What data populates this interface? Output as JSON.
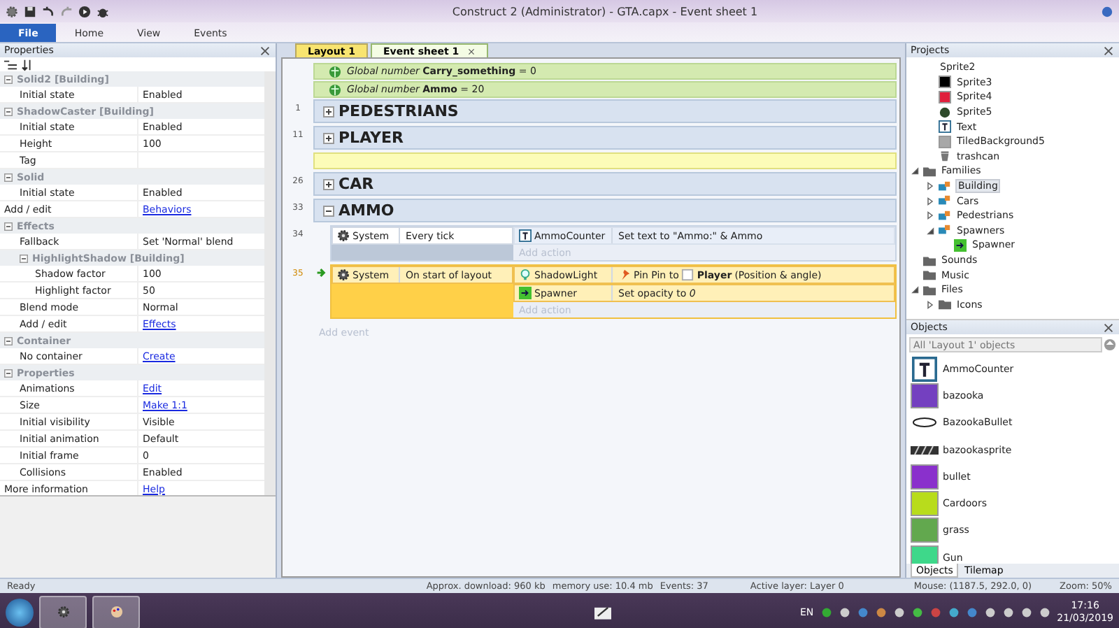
{
  "window": {
    "title": "Construct 2 (Administrator) - GTA.capx - Event sheet 1"
  },
  "ribbon_tabs": [
    {
      "label": "File",
      "kind": "file",
      "selected": false
    },
    {
      "label": "Home",
      "kind": "tab",
      "selected": false
    },
    {
      "label": "View",
      "kind": "tab",
      "selected": false
    },
    {
      "label": "Events",
      "kind": "tab",
      "selected": false
    }
  ],
  "properties": {
    "title": "Properties",
    "items": [
      {
        "kind": "group",
        "children": [
          {
            "kind": "group",
            "label": "Solid2 [Building]",
            "children": [
              {
                "kind": "row",
                "label": "Initial state",
                "value": "Enabled",
                "link": false
              }
            ]
          },
          {
            "kind": "group",
            "label": "ShadowCaster [Building]",
            "children": [
              {
                "kind": "row",
                "label": "Initial state",
                "value": "Enabled",
                "link": false
              },
              {
                "kind": "row",
                "label": "Height",
                "value": "100",
                "link": false
              },
              {
                "kind": "row",
                "label": "Tag"
              }
            ]
          },
          {
            "kind": "group",
            "label": "Solid",
            "children": [
              {
                "kind": "row",
                "label": "Initial state",
                "value": "Enabled",
                "link": false
              }
            ]
          },
          {
            "kind": "row",
            "label": "Add / edit",
            "value": "Behaviors",
            "link": true
          }
        ]
      },
      {
        "kind": "group",
        "label": "Effects",
        "children": [
          {
            "kind": "row",
            "label": "Fallback",
            "value": "Set 'Normal' blend",
            "link": false
          },
          {
            "kind": "group",
            "label": "HighlightShadow [Building]",
            "children": [
              {
                "kind": "row",
                "label": "Shadow factor",
                "value": "100",
                "link": false
              },
              {
                "kind": "row",
                "label": "Highlight factor",
                "value": "50",
                "link": false
              }
            ]
          },
          {
            "kind": "row",
            "label": "Blend mode",
            "value": "Normal",
            "link": false
          },
          {
            "kind": "row",
            "label": "Add / edit",
            "value": "Effects",
            "link": true
          }
        ]
      },
      {
        "kind": "group",
        "label": "Container",
        "children": [
          {
            "kind": "row",
            "label": "No container",
            "value": "Create",
            "link": true
          }
        ]
      },
      {
        "kind": "group",
        "label": "Properties",
        "children": [
          {
            "kind": "row",
            "label": "Animations",
            "value": "Edit",
            "link": true
          },
          {
            "kind": "row",
            "label": "Size",
            "value": "Make 1:1",
            "link": true
          },
          {
            "kind": "row",
            "label": "Initial visibility",
            "value": "Visible",
            "link": false
          },
          {
            "kind": "row",
            "label": "Initial animation",
            "value": "Default",
            "link": false
          },
          {
            "kind": "row",
            "label": "Initial frame",
            "value": "0",
            "link": false
          },
          {
            "kind": "row",
            "label": "Collisions",
            "value": "Enabled",
            "link": false
          }
        ]
      },
      {
        "kind": "row",
        "label": "More information",
        "value": "Help",
        "link": true
      }
    ]
  },
  "doc_tabs": [
    {
      "label": "Layout 1",
      "kind": "layout",
      "selected": false
    },
    {
      "label": "Event sheet 1",
      "kind": "events",
      "selected": true
    }
  ],
  "event_sheet": {
    "rows": [
      {
        "kind": "global",
        "text": "*Global number* **Carry_something** = 0"
      },
      {
        "kind": "global",
        "text": "*Global number* **Ammo** = 20"
      },
      {
        "kind": "group",
        "number": "1",
        "title": "PEDESTRIANS",
        "expanded": false
      },
      {
        "kind": "group",
        "number": "11",
        "title": "PLAYER",
        "expanded": false
      },
      {
        "kind": "comment"
      },
      {
        "kind": "group",
        "number": "26",
        "title": "CAR",
        "expanded": false
      },
      {
        "kind": "group",
        "number": "33",
        "title": "AMMO",
        "expanded": true,
        "children": [
          {
            "kind": "event",
            "number": "34",
            "selected": false,
            "trigger": false,
            "conditions": [
              {
                "object": "System",
                "kind": "system",
                "text": "Every tick"
              }
            ],
            "actions": [
              {
                "object": "AmmoCounter",
                "kind": "text_object",
                "text": "Set text to \"Ammo:\" & Ammo"
              }
            ],
            "add_action": "Add action"
          },
          {
            "kind": "event",
            "number": "35",
            "selected": true,
            "trigger": true,
            "conditions": [
              {
                "object": "System",
                "kind": "system",
                "text": "On start of layout"
              }
            ],
            "actions": [
              {
                "object": "ShadowLight",
                "kind": "light",
                "text": "Pin Pin to",
                "param_object": "Player",
                "suffix": "(Position & angle)"
              },
              {
                "object": "Spawner",
                "kind": "sprite",
                "text": "Set opacity to *0*"
              }
            ],
            "add_action": "Add action"
          }
        ]
      }
    ],
    "add_event": "Add event"
  },
  "projects": {
    "title": "Projects",
    "tree": [
      {
        "children": [
          {
            "children": [
              {
                "label": "Sprite2",
                "kind": "none",
                "selected": false
              },
              {
                "label": "Sprite3",
                "kind": "swatch",
                "color": "#000000",
                "selected": false
              },
              {
                "label": "Sprite4",
                "kind": "swatch",
                "color": "#e0203c",
                "selected": false
              },
              {
                "label": "Sprite5",
                "kind": "blob",
                "color": "#2e4a2a",
                "selected": false
              },
              {
                "label": "Text",
                "kind": "text",
                "selected": false
              },
              {
                "label": "TiledBackground5",
                "kind": "swatch",
                "color": "#a8a8a8",
                "selected": false
              },
              {
                "label": "trashcan",
                "kind": "trash",
                "selected": false
              }
            ]
          },
          {
            "label": "Families",
            "kind": "folder",
            "expanded": true,
            "selected": false,
            "children": [
              {
                "label": "Building",
                "kind": "family",
                "expanded": false,
                "selected": true
              },
              {
                "label": "Cars",
                "kind": "family",
                "expanded": false,
                "selected": false
              },
              {
                "label": "Pedestrians",
                "kind": "family",
                "expanded": false,
                "selected": false
              },
              {
                "label": "Spawners",
                "kind": "family",
                "expanded": true,
                "selected": false,
                "children": [
                  {
                    "label": "Spawner",
                    "kind": "arrow",
                    "selected": false
                  }
                ]
              }
            ]
          },
          {
            "label": "Sounds",
            "kind": "folder",
            "selected": false
          },
          {
            "label": "Music",
            "kind": "folder",
            "selected": false
          },
          {
            "label": "Files",
            "kind": "folder",
            "expanded": true,
            "selected": false,
            "children": [
              {
                "label": "Icons",
                "kind": "folder",
                "expanded": false,
                "selected": false
              }
            ]
          }
        ]
      }
    ]
  },
  "objects": {
    "title": "Objects",
    "filter_placeholder": "All 'Layout 1' objects",
    "items": [
      {
        "label": "AmmoCounter",
        "kind": "text"
      },
      {
        "label": "bazooka",
        "kind": "swatch",
        "color": "#7440c0"
      },
      {
        "label": "BazookaBullet",
        "kind": "ellipse"
      },
      {
        "label": "bazookasprite",
        "kind": "stripes"
      },
      {
        "label": "bullet",
        "kind": "swatch",
        "color": "#8a30cc"
      },
      {
        "label": "Cardoors",
        "kind": "swatch",
        "color": "#b8dc1c"
      },
      {
        "label": "grass",
        "kind": "swatch",
        "color": "#62a84e"
      },
      {
        "label": "Gun",
        "kind": "swatch",
        "color": "#3ed88a"
      }
    ],
    "tabs": [
      {
        "label": "Objects",
        "selected": true
      },
      {
        "label": "Tilemap",
        "selected": false
      }
    ]
  },
  "status_bar": {
    "left": "Ready",
    "download": "Approx. download: 960 kb",
    "memory": "memory use: 10.4 mb",
    "events": "Events: 37",
    "layer": "Active layer: Layer 0",
    "mouse": "Mouse: (1187.5, 292.0, 0)",
    "zoom": "Zoom: 50%"
  },
  "taskbar": {
    "language": "EN",
    "time": "17:16",
    "date": "21/03/2019"
  }
}
